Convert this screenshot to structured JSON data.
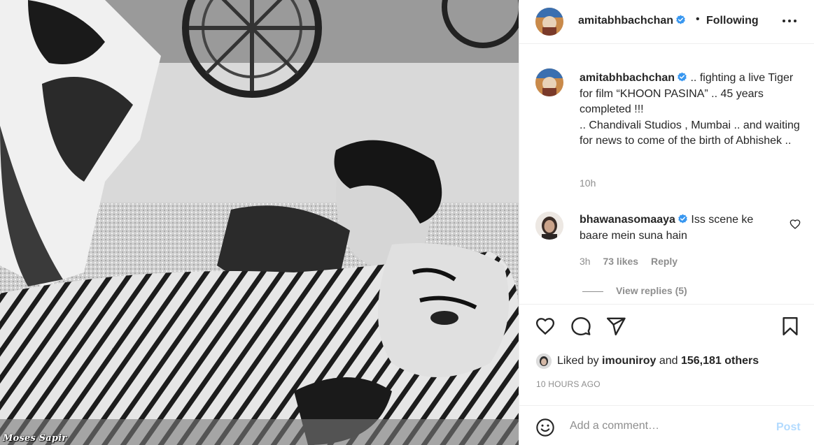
{
  "photo": {
    "watermark": "Moses Sapir"
  },
  "header": {
    "username": "amitabhbachchan",
    "separator": "•",
    "follow_status": "Following",
    "more_icon": "more-horizontal-icon"
  },
  "caption": {
    "username": "amitabhbachchan",
    "text": " .. fighting a live Tiger for film “KHOON PASINA” .. 45 years completed !!!",
    "text_line2": ".. Chandivali Studios , Mumbai .. and waiting for news to come of the birth of Abhishek ..",
    "time": "10h"
  },
  "comment": {
    "username": "bhawanasomaaya",
    "text": " Iss scene ke baare mein suna hain",
    "time": "3h",
    "likes": "73 likes",
    "reply": "Reply",
    "view_replies": "View replies (5)"
  },
  "actions": {
    "like_icon": "heart-icon",
    "comment_icon": "comment-icon",
    "share_icon": "send-icon",
    "save_icon": "bookmark-icon"
  },
  "likes": {
    "prefix": "Liked by ",
    "user": "imouniroy",
    "middle": " and ",
    "others": "156,181 others"
  },
  "posted": "10 HOURS AGO",
  "add_comment": {
    "placeholder": "Add a comment…",
    "post_label": "Post"
  },
  "colors": {
    "verified": "#3897f0",
    "muted": "#8e8e8e",
    "post_disabled": "#b3dbff"
  }
}
